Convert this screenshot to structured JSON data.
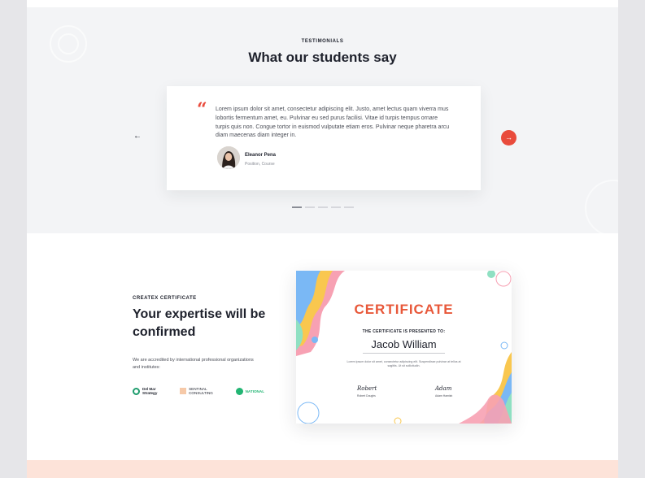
{
  "testimonials": {
    "eyebrow": "TESTIMONIALS",
    "heading": "What our students say",
    "quote_mark": "“",
    "quote": "Lorem ipsum dolor sit amet, consectetur adipiscing elit. Justo, amet lectus quam viverra mus lobortis fermentum amet, eu. Pulvinar eu sed purus facilisi. Vitae id turpis tempus ornare turpis quis non. Congue tortor in euismod vulputate etiam eros. Pulvinar neque pharetra arcu diam maecenas diam integer in.",
    "author_name": "Eleanor Pena",
    "author_role": "Position, Course",
    "prev_arrow": "←",
    "next_arrow": "→",
    "slide_count": 5,
    "active_slide": 1
  },
  "certificate_section": {
    "eyebrow": "CREATEX CERTIFICATE",
    "title": "Your expertise will be confirmed",
    "description": "We are accredited by international professional organizations and institutes:",
    "partners": [
      {
        "name": "Del Mar Strategy",
        "line1": "Del Mar",
        "line2": "Strategy"
      },
      {
        "name": "Sentinal Consulting",
        "line1": "SENTINAL",
        "line2": "CONSULTING"
      },
      {
        "name": "National",
        "line1": "NATIONAL",
        "line2": ""
      }
    ]
  },
  "certificate": {
    "heading": "CERTIFICATE",
    "presented_to": "THE CERTIFICATE IS PRESENTED TO:",
    "recipient": "Jacob William",
    "body": "Lorem ipsum dolor sit amet, consectetur adipiscing elit. Suspendisse pulvinar at tellus at sagittis. Ut sit sollicitudin.",
    "signature_left": "Robert",
    "signer_left": "Robert Doughs",
    "signature_right": "Adam",
    "signer_right": "Adam Hamish"
  },
  "colors": {
    "accent": "#e94b3c",
    "section_bg": "#f3f4f6",
    "heading_text": "#1e212c",
    "certificate_title": "#e8583a",
    "footer_band": "#fde3d9"
  }
}
